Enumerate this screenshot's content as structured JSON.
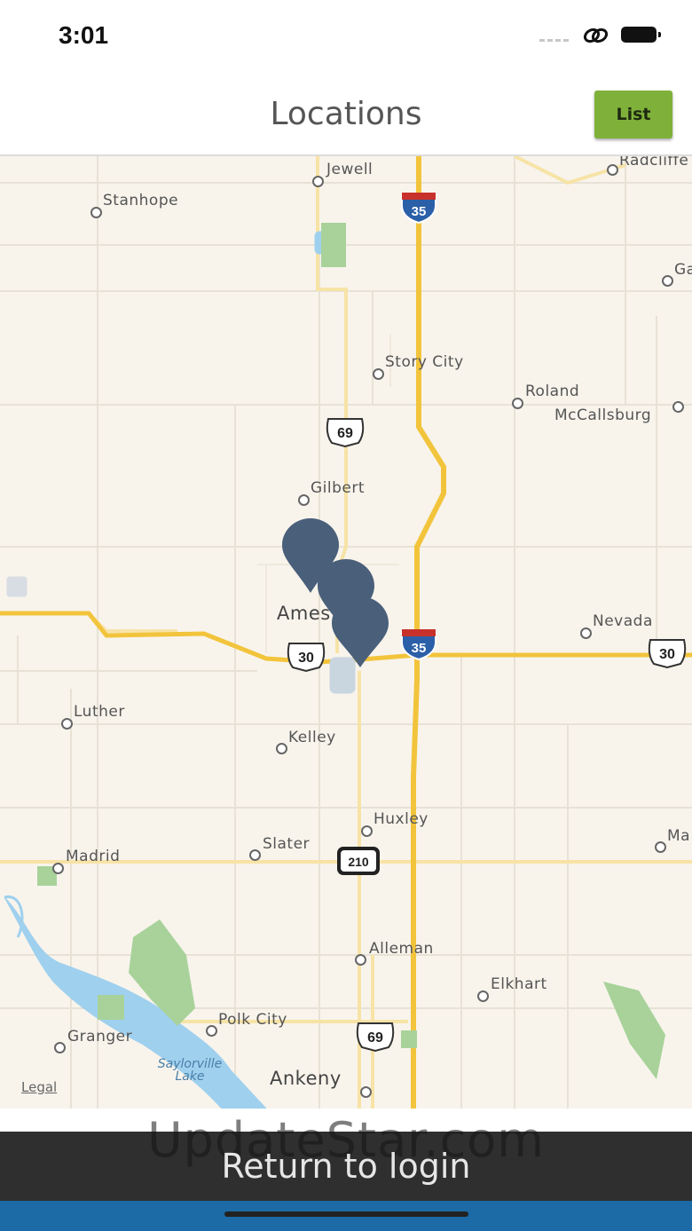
{
  "status": {
    "time": "3:01"
  },
  "nav": {
    "title": "Locations",
    "list_label": "List"
  },
  "map": {
    "places": [
      {
        "name": "Jewell"
      },
      {
        "name": "Radcliffe"
      },
      {
        "name": "Stanhope"
      },
      {
        "name": "Ga"
      },
      {
        "name": "Story City"
      },
      {
        "name": "Roland"
      },
      {
        "name": "McCallsburg"
      },
      {
        "name": "Gilbert"
      },
      {
        "name": "Ames"
      },
      {
        "name": "Nevada"
      },
      {
        "name": "Luther"
      },
      {
        "name": "Kelley"
      },
      {
        "name": "Huxley"
      },
      {
        "name": "Slater"
      },
      {
        "name": "Madrid"
      },
      {
        "name": "Ma"
      },
      {
        "name": "Alleman"
      },
      {
        "name": "Elkhart"
      },
      {
        "name": "Polk City"
      },
      {
        "name": "Granger"
      },
      {
        "name": "Ankeny"
      }
    ],
    "lake": "Saylorville Lake",
    "shields": {
      "i35": "35",
      "us69": "69",
      "us30": "30",
      "ia210": "210"
    },
    "legal": "Legal",
    "pins": 3
  },
  "footer": {
    "watermark": "UpdateStar.com",
    "return_label": "Return to login"
  },
  "colors": {
    "accent_green": "#7fb13a",
    "pin": "#4a5f7a",
    "footer_dark": "#2f2f2f",
    "footer_blue": "#1c6aa6",
    "highway": "#f2c43c",
    "water": "#9fd0ee",
    "park": "#a8d29a"
  }
}
